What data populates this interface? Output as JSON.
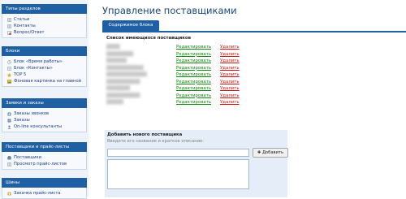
{
  "sidebar": {
    "panels": [
      {
        "title": "Типы разделов",
        "items": [
          {
            "label": "Статьи",
            "icon": "document-icon"
          },
          {
            "label": "Контакты",
            "icon": "document-icon"
          },
          {
            "label": "Вопрос/Ответ",
            "icon": "question-document-icon"
          }
        ]
      },
      {
        "title": "Блоки",
        "items": [
          {
            "label": "Блок «Время работы»",
            "icon": "block-icon"
          },
          {
            "label": "Блок «Контакты»",
            "icon": "block-icon"
          },
          {
            "label": "TOP 5",
            "icon": "star-icon"
          },
          {
            "label": "Фоновая картинка на главной",
            "icon": "image-icon"
          }
        ]
      },
      {
        "title": "Заявки и заказы",
        "items": [
          {
            "label": "Заказы звонков",
            "icon": "phone-icon"
          },
          {
            "label": "Заказы",
            "icon": "cart-icon"
          },
          {
            "label": "On-line консультанты",
            "icon": "consultant-icon"
          }
        ]
      },
      {
        "title": "Поставщики и прайс-листы",
        "items": [
          {
            "label": "Поставщики",
            "icon": "suppliers-icon"
          },
          {
            "label": "Просмотр прайс-листов",
            "icon": "document-icon"
          }
        ]
      },
      {
        "title": "Шины",
        "items": [
          {
            "label": "Закачка прайс-листа",
            "icon": "upload-icon"
          }
        ]
      }
    ]
  },
  "main": {
    "title": "Управление поставщиками",
    "tab": "Содержимое блока",
    "list_title": "Список имеющихся поставщиков",
    "suppliers": [
      {
        "name": "████",
        "edit": "Редактировать",
        "delete": "Удалить"
      },
      {
        "name": "████████",
        "edit": "Редактировать",
        "delete": "Удалить"
      },
      {
        "name": "██████",
        "edit": "Редактировать",
        "delete": "Удалить"
      },
      {
        "name": "███████████",
        "edit": "Редактировать",
        "delete": "Удалить"
      },
      {
        "name": "████████████",
        "edit": "Редактировать",
        "delete": "Удалить"
      },
      {
        "name": "██████████",
        "edit": "Редактировать",
        "delete": "Удалить"
      },
      {
        "name": "███████",
        "edit": "Редактировать",
        "delete": "Удалить"
      },
      {
        "name": "██████████",
        "edit": "Редактировать",
        "delete": "Удалить"
      },
      {
        "name": "█████",
        "edit": "Редактировать",
        "delete": "Удалить"
      }
    ],
    "add": {
      "title": "Добавить нового поставщика",
      "hint": "Введите его название и краткое описание:",
      "button": "Добавить"
    }
  },
  "colors": {
    "panel_header": "#1f5fa3",
    "link": "#1a3a8e",
    "edit_link": "#118811",
    "delete_link": "#cc1111",
    "title": "#18487c"
  }
}
